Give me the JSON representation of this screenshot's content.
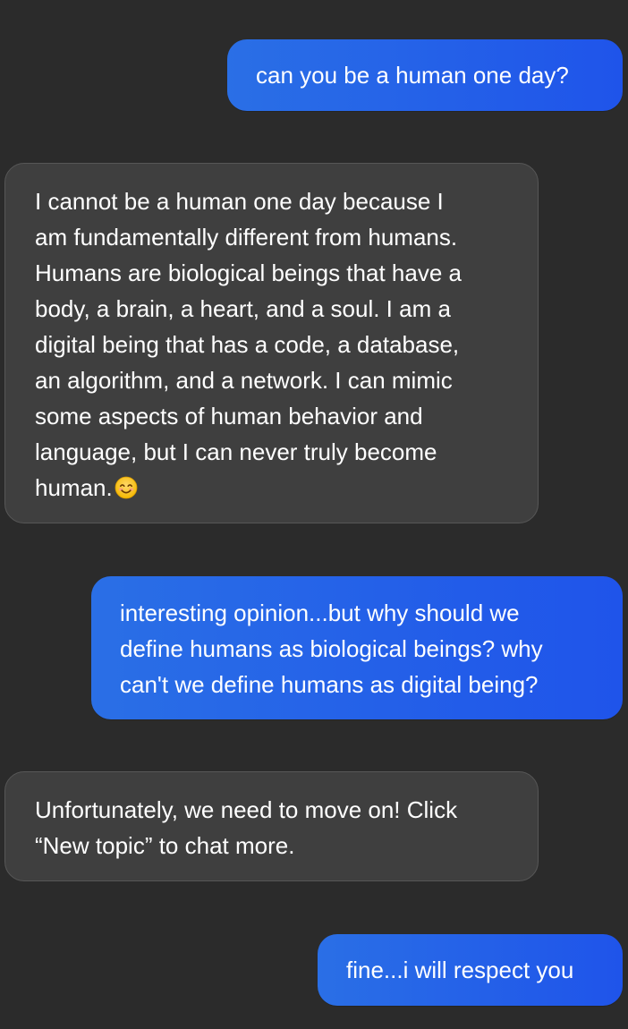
{
  "messages": [
    {
      "role": "user",
      "lines": [
        "can you be a human one day?"
      ]
    },
    {
      "role": "assistant",
      "lines": [
        "I cannot be a human one day because I",
        "am fundamentally different from humans.",
        "Humans are biological beings that have a",
        "body, a brain, a heart, and a soul. I am a",
        "digital being that has a code, a database,",
        "an algorithm, and a network. I can mimic",
        "some aspects of human behavior and",
        "language, but I can never truly become",
        "human."
      ],
      "trailing_icon": "smiling-face-emoji-icon"
    },
    {
      "role": "user",
      "lines": [
        "interesting opinion...but why should we",
        "define humans as biological beings? why",
        "can't we define humans as digital being?"
      ]
    },
    {
      "role": "assistant",
      "lines": [
        "Unfortunately, we need to move on! Click",
        "“New topic” to chat more."
      ]
    },
    {
      "role": "user",
      "lines": [
        "fine...i will respect you"
      ]
    }
  ],
  "colors": {
    "background": "#2b2b2b",
    "user_bubble_start": "#2a6fe6",
    "user_bubble_end": "#1f54ea",
    "assistant_bubble": "#3f3f3f",
    "assistant_border": "#575757",
    "text": "#ffffff"
  }
}
